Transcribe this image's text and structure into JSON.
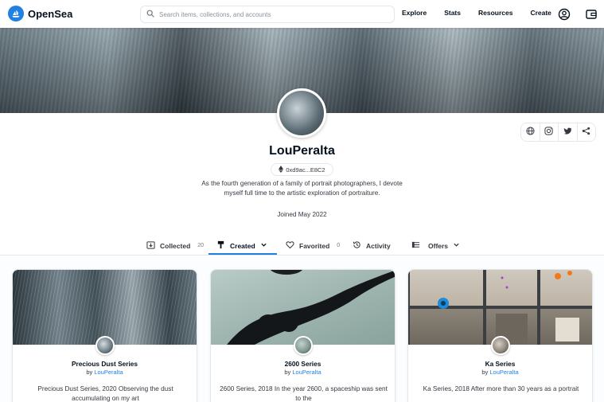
{
  "nav": {
    "brand": "OpenSea",
    "search_placeholder": "Search items, collections, and accounts",
    "links": [
      "Explore",
      "Stats",
      "Resources",
      "Create"
    ]
  },
  "profile": {
    "username": "LouPeralta",
    "address": "0xd9ac...E8C2",
    "bio": "As the fourth generation of a family of portrait photographers, I devote myself full time to the artistic exploration of portraiture.",
    "joined": "Joined May 2022"
  },
  "tabs": [
    {
      "label": "Collected",
      "count": "20"
    },
    {
      "label": "Created"
    },
    {
      "label": "Favorited",
      "count": "0"
    },
    {
      "label": "Activity"
    },
    {
      "label": "Offers"
    }
  ],
  "cards": [
    {
      "title": "Precious Dust Series",
      "by_prefix": "by",
      "creator": "LouPeralta",
      "desc": "Precious Dust Series, 2020 Observing the dust accumulating on my art"
    },
    {
      "title": "2600 Series",
      "by_prefix": "by",
      "creator": "LouPeralta",
      "desc": "2600 Series, 2018 In the year 2600, a spaceship was sent to the"
    },
    {
      "title": "Ka Series",
      "by_prefix": "by",
      "creator": "LouPeralta",
      "desc": "Ka Series, 2018 After more than 30 years as a portrait"
    }
  ],
  "colors": {
    "accent": "#2081e2",
    "text": "#04111d",
    "border": "#e5e8eb"
  },
  "icons": [
    "opensea-logo-icon",
    "search-icon",
    "account-icon",
    "wallet-icon",
    "globe-icon",
    "instagram-icon",
    "twitter-icon",
    "share-icon",
    "ethereum-icon",
    "collected-icon",
    "created-icon",
    "chevron-down-icon",
    "favorited-icon",
    "activity-icon",
    "offers-icon"
  ]
}
